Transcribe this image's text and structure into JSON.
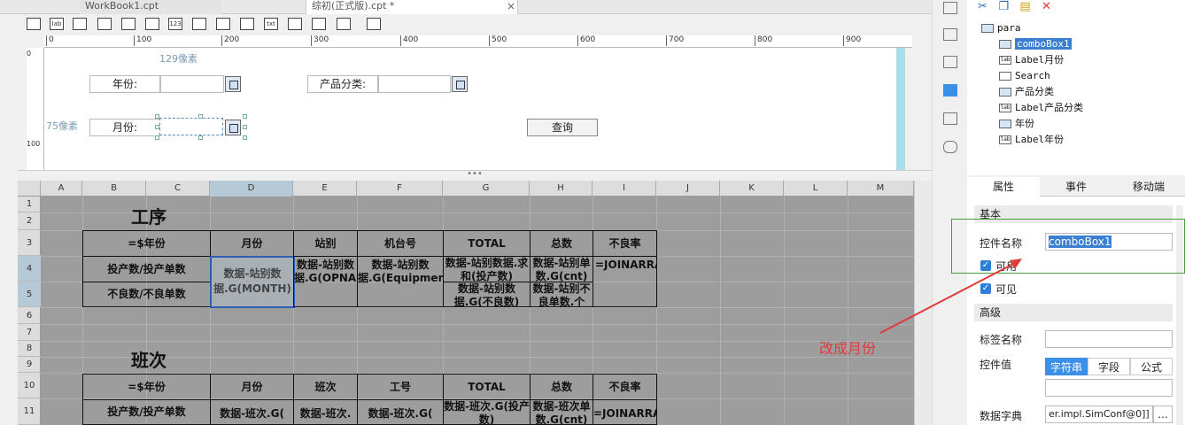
{
  "tabs": [
    {
      "label": "WorkBook1.cpt"
    },
    {
      "label": "综初(正式版).cpt *",
      "close": "×"
    }
  ],
  "toolbar": {
    "icons": [
      "textbox-icon",
      "label-icon",
      "button-icon",
      "combobox-icon",
      "date-icon",
      "number-icon",
      "checkbox-group-icon",
      "radio-group-icon",
      "textarea-icon",
      "password-icon",
      "tree-icon",
      "list-icon",
      "report-icon"
    ],
    "label_icon_text": "lab",
    "number_icon_text": "123",
    "text_icon_text": "txt"
  },
  "ruler": {
    "h_ticks": [
      "0",
      "100",
      "200",
      "300",
      "400",
      "500",
      "600",
      "700",
      "800",
      "900"
    ],
    "v_ticks": [
      "0",
      "100"
    ]
  },
  "form": {
    "dim_top": "129像素",
    "dim_left": "75像素",
    "label_year": "年份:",
    "label_category": "产品分类:",
    "label_month": "月份:",
    "query_button": "查询"
  },
  "divider_grip": "•••",
  "columns": [
    "A",
    "B",
    "C",
    "D",
    "E",
    "F",
    "G",
    "H",
    "I",
    "J",
    "K",
    "L",
    "M"
  ],
  "rows": [
    "1",
    "2",
    "3",
    "4",
    "5",
    "6",
    "7",
    "8",
    "9",
    "10",
    "11"
  ],
  "sheet": {
    "t1": "工序",
    "t2": "班次",
    "h1": [
      "=$年份",
      "月份",
      "站别",
      "机台号",
      "TOTAL",
      "总数",
      "不良率"
    ],
    "r4": [
      "投产数/投产单数",
      "数据-站别数据.G(MONTH)",
      "数据-站别数据.G(OPNAME)",
      "数据-站别数据.G(EquipmentName",
      "数据-站别数据.求和(投产数)",
      "数据-站别单数.G(cnt)",
      "=JOINARRAY("
    ],
    "r5": [
      "不良数/不良单数",
      "数据-站别数据.G(不良数)",
      "数据-站别不良单数.个"
    ],
    "h2": [
      "=$年份",
      "月份",
      "班次",
      "工号",
      "TOTAL",
      "总数",
      "不良率"
    ],
    "r11": [
      "投产数/投产单数",
      "数据-班次.G(",
      "数据-班次.",
      "数据-班次.G(",
      "数据-班次.G(投产数)",
      "数据-班次单数.G(cnt)",
      "=JOINARRA"
    ]
  },
  "tree": {
    "items": [
      {
        "label": "para",
        "icon": "form-icon"
      },
      {
        "label": "comboBox1",
        "icon": "combobox-icon",
        "selected": true
      },
      {
        "label": "Label月份",
        "icon": "label-icon"
      },
      {
        "label": "Search",
        "icon": "search-icon"
      },
      {
        "label": "产品分类",
        "icon": "combobox-icon"
      },
      {
        "label": "Label产品分类",
        "icon": "label-icon"
      },
      {
        "label": "年份",
        "icon": "combobox-icon"
      },
      {
        "label": "Label年份",
        "icon": "label-icon"
      }
    ]
  },
  "prop_tabs": [
    "属性",
    "事件",
    "移动端"
  ],
  "props": {
    "basic": "基本",
    "name_label": "控件名称",
    "name_value": "comboBox1",
    "enabled": "可用",
    "visible": "可见",
    "advanced": "高级",
    "tag_label": "标签名称",
    "value_label": "控件值",
    "value_types": [
      "字符串",
      "字段",
      "公式"
    ],
    "dict_label": "数据字典",
    "dict_value": "er.impl.SimConf@0]]",
    "dict_btn": "…"
  },
  "annotation": "改成月份",
  "colors": {
    "annotation": "#e23a3a",
    "selection": "#2a5fb5",
    "accent": "#3b8fe6"
  }
}
